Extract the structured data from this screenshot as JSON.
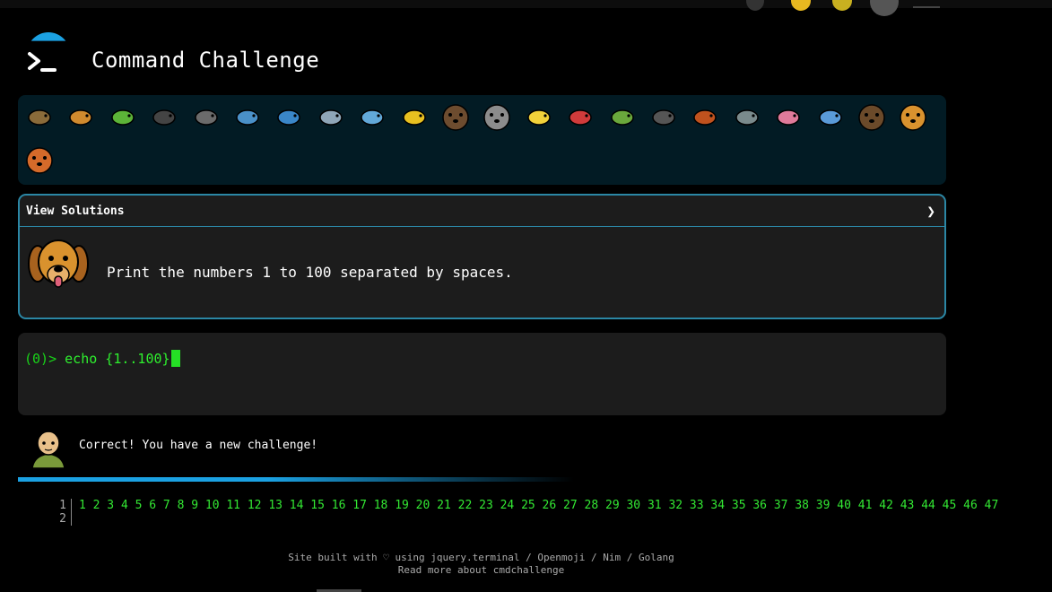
{
  "app": {
    "title": "Command Challenge",
    "logo_icon": "terminal-icon"
  },
  "colors": {
    "accent": "#1ba1e2",
    "prompt_green": "#2ef02e",
    "panel_bg": "#1c1c1c",
    "animals_bg": "#021b24",
    "border": "#2b87a5"
  },
  "animals": [
    {
      "name": "snail",
      "color": "#8a6b3a"
    },
    {
      "name": "butterfly",
      "color": "#d08a2e"
    },
    {
      "name": "caterpillar",
      "color": "#5cb338"
    },
    {
      "name": "ant",
      "color": "#444444"
    },
    {
      "name": "spider-web",
      "color": "#6b6b6b"
    },
    {
      "name": "whale",
      "color": "#4a90c8"
    },
    {
      "name": "shark",
      "color": "#3a86c8"
    },
    {
      "name": "dolphin",
      "color": "#8fa6b8"
    },
    {
      "name": "fish",
      "color": "#62a8d8"
    },
    {
      "name": "tropical-fish",
      "color": "#e8c020"
    },
    {
      "name": "hedgehog",
      "color": "#6d4c2f"
    },
    {
      "name": "wolf",
      "color": "#8c8c8c"
    },
    {
      "name": "bee",
      "color": "#f2d23a"
    },
    {
      "name": "ladybug",
      "color": "#d13b3b"
    },
    {
      "name": "cricket",
      "color": "#6aa83c"
    },
    {
      "name": "spider",
      "color": "#555555"
    },
    {
      "name": "scorpion",
      "color": "#c0521e"
    },
    {
      "name": "fly",
      "color": "#7a8a8c"
    },
    {
      "name": "worm",
      "color": "#e07a9a"
    },
    {
      "name": "microbe",
      "color": "#5a9ad8"
    },
    {
      "name": "monkey",
      "color": "#6b4a2a"
    },
    {
      "name": "dog",
      "color": "#d9922e"
    },
    {
      "name": "fox",
      "color": "#d46a2a"
    }
  ],
  "solutions": {
    "header_label": "View Solutions",
    "chevron_icon": "chevron-right-icon",
    "challenge_icon": "dog-face-icon",
    "task": "Print the numbers 1 to 100 separated by spaces."
  },
  "terminal": {
    "prompt": "(0)>",
    "command": "echo {1..100}"
  },
  "result": {
    "icon": "elf-icon",
    "message": "Correct! You have a new challenge!"
  },
  "output": {
    "line_numbers": [
      "1",
      "2"
    ],
    "line1": "1 2 3 4 5 6 7 8 9 10 11 12 13 14 15 16 17 18 19 20 21 22 23 24 25 26 27 28 29 30 31 32 33 34 35 36 37 38 39 40 41 42 43 44 45 46 47",
    "line2": ""
  },
  "footer": {
    "line1": "Site built with ♡ using jquery.terminal / Openmoji / Nim / Golang",
    "line2": "Read more about cmdchallenge"
  }
}
